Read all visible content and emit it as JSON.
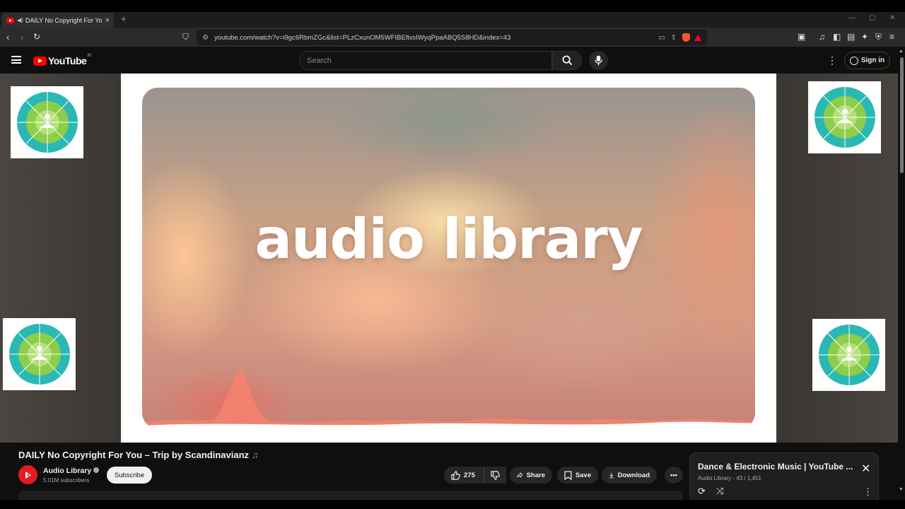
{
  "browser": {
    "tab_title": "DAILY No Copyright For You",
    "tab_audio_icon": "speaker-icon",
    "url": "youtube.com/watch?v=i9gc6RbmZGc&list=PLzCxunOM5WFIBEfixsIWyqPpaABQ5S8HD&index=43",
    "new_tab_glyph": "+",
    "close_glyph": "×"
  },
  "header": {
    "logo_text": "YouTube",
    "country_code": "IN",
    "search_placeholder": "Search",
    "sign_in_label": "Sign in"
  },
  "player": {
    "overlay_title": "audio library"
  },
  "video": {
    "title": "DAILY No Copyright For You – Trip by Scandinavianz",
    "title_emoji": "♫",
    "channel_name": "Audio Library",
    "subscribers": "5.01M subscribers",
    "subscribe_label": "Subscribe",
    "like_count": "275",
    "share_label": "Share",
    "save_label": "Save",
    "download_label": "Download"
  },
  "playlist": {
    "title": "Dance & Electronic Music | YouTube ...",
    "meta": "Audio Library - 43 / 1,451"
  },
  "colors": {
    "accent": "#ff0000",
    "background": "#0f0f0f",
    "wheel_teal": "#2ab8b5",
    "wheel_green": "#8ccd4a"
  }
}
